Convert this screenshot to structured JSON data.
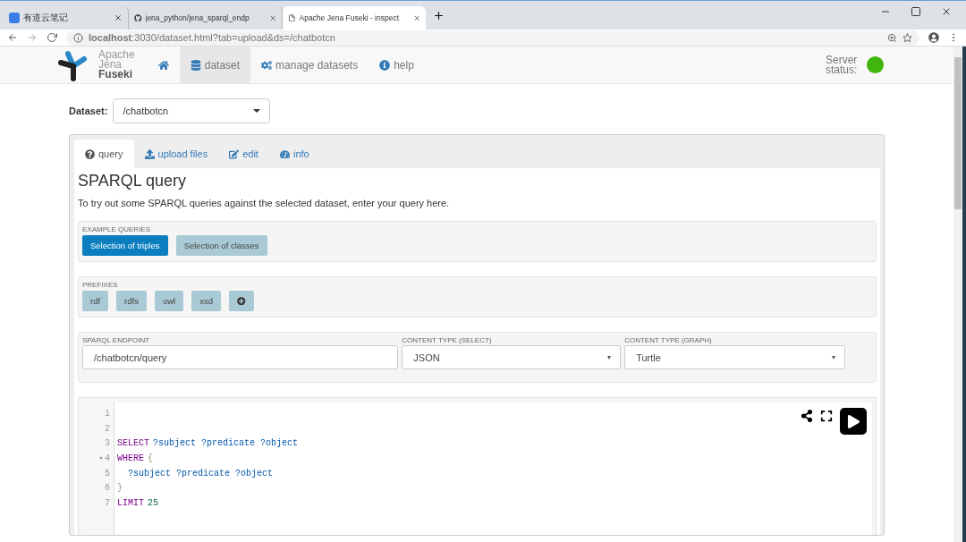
{
  "browser": {
    "tabs": [
      {
        "title": "有道云笔记",
        "kind": "note",
        "selected": false
      },
      {
        "title": "jena_python/jena_sparql_endp",
        "kind": "github",
        "selected": false
      },
      {
        "title": "Apache Jena Fuseki - inspect",
        "kind": "page",
        "selected": true
      }
    ],
    "url": "**localhost**:3030/dataset.html?tab=upload&ds=/chatbotcn"
  },
  "navbar": {
    "logo": [
      "Apache",
      "Jena",
      "Fuseki"
    ],
    "items": [
      {
        "kind": "home",
        "selected": false
      },
      {
        "kind": "dataset",
        "label": "dataset",
        "selected": true
      },
      {
        "kind": "manage",
        "label": "manage datasets",
        "selected": false
      },
      {
        "kind": "help",
        "label": "help",
        "selected": false
      }
    ],
    "server": {
      "label": "Server status:",
      "color": "#3fb60c"
    }
  },
  "dataset": {
    "label": "Dataset:",
    "value": "/chatbotcn"
  },
  "tabs": [
    {
      "kind": "query",
      "label": "query",
      "selected": true
    },
    {
      "kind": "upload",
      "label": "upload files",
      "selected": false
    },
    {
      "kind": "edit",
      "label": "edit",
      "selected": false
    },
    {
      "kind": "info",
      "label": "info",
      "selected": false
    }
  ],
  "heading": "SPARQL query",
  "description": "To try out some SPARQL queries against the selected dataset, enter your query here.",
  "examples": {
    "label": "EXAMPLE QUERIES",
    "buttons": [
      {
        "label": "Selection of triples",
        "selected": true
      },
      {
        "label": "Selection of classes",
        "selected": false
      }
    ]
  },
  "prefixes": {
    "label": "PREFIXES",
    "buttons": [
      "rdf",
      "rdfs",
      "owl",
      "xsd"
    ]
  },
  "endpoint": {
    "fields": [
      {
        "label": "SPARQL ENDPOINT",
        "value": "/chatbotcn/query",
        "kind": "input"
      },
      {
        "label": "CONTENT TYPE (SELECT)",
        "value": "JSON",
        "kind": "select"
      },
      {
        "label": "CONTENT TYPE (GRAPH)",
        "value": "Turtle",
        "kind": "select"
      }
    ]
  },
  "editor": {
    "lines": [
      {
        "number": "1",
        "fold": false
      },
      {
        "number": "2",
        "fold": false
      },
      {
        "number": "3",
        "fold": false,
        "tokens": [
          {
            "kind": "keyword",
            "text": "SELECT"
          },
          {
            "kind": "variable",
            "text": "?subject ?predicate ?object"
          }
        ]
      },
      {
        "number": "4",
        "fold": true,
        "tokens": [
          {
            "kind": "keyword",
            "text": "WHERE"
          },
          {
            "kind": "bracket",
            "text": "{"
          }
        ]
      },
      {
        "number": "5",
        "fold": false,
        "tokens": [
          {
            "kind": "variable",
            "text": "  ?subject ?predicate ?object"
          }
        ]
      },
      {
        "number": "6",
        "fold": false,
        "tokens": [
          {
            "kind": "bracket",
            "text": "}"
          }
        ]
      },
      {
        "number": "7",
        "fold": false,
        "tokens": [
          {
            "kind": "keyword",
            "text": "LIMIT"
          },
          {
            "kind": "number",
            "text": "25"
          }
        ]
      }
    ]
  }
}
